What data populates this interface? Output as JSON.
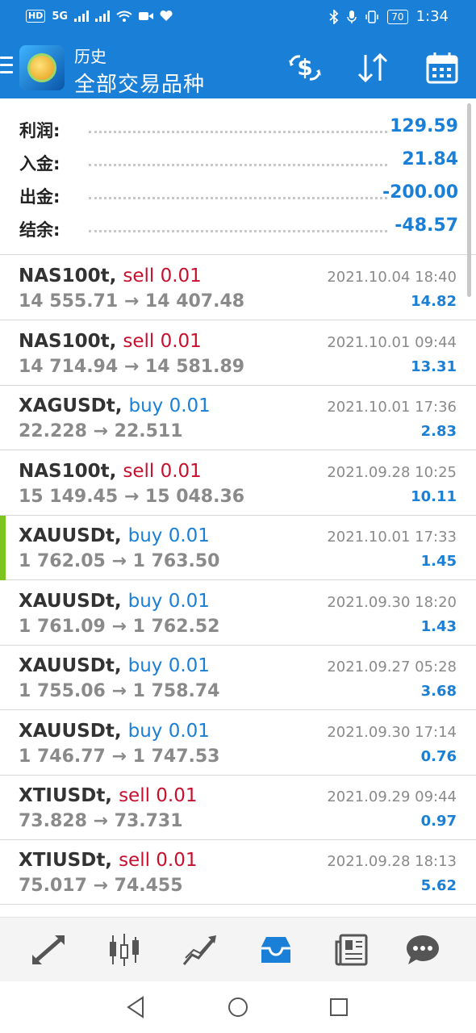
{
  "status_bar": {
    "badges": [
      "HD",
      "5G",
      "HD"
    ],
    "battery": "70",
    "time": "1:34",
    "icons": [
      "signal-icon",
      "wifi-icon",
      "video-icon",
      "heart-icon",
      "bluetooth-icon",
      "mic-icon",
      "vibrate-icon",
      "battery-icon"
    ]
  },
  "app_bar": {
    "subtitle": "历史",
    "title": "全部交易品种",
    "icons": [
      "currency-exchange-icon",
      "sort-icon",
      "calendar-icon"
    ]
  },
  "summary": [
    {
      "label": "利润:",
      "value": "129.59"
    },
    {
      "label": "入金:",
      "value": "21.84"
    },
    {
      "label": "出金:",
      "value": "-200.00"
    },
    {
      "label": "结余:",
      "value": "-48.57"
    }
  ],
  "trades": [
    {
      "symbol": "NAS100t,",
      "type": "sell 0.01",
      "side": "sell",
      "prices": "14 555.71 → 14 407.48",
      "time": "2021.10.04 18:40",
      "profit": "14.82"
    },
    {
      "symbol": "NAS100t,",
      "type": "sell 0.01",
      "side": "sell",
      "prices": "14 714.94 → 14 581.89",
      "time": "2021.10.01 09:44",
      "profit": "13.31"
    },
    {
      "symbol": "XAGUSDt,",
      "type": "buy 0.01",
      "side": "buy",
      "prices": "22.228 → 22.511",
      "time": "2021.10.01 17:36",
      "profit": "2.83"
    },
    {
      "symbol": "NAS100t,",
      "type": "sell 0.01",
      "side": "sell",
      "prices": "15 149.45 → 15 048.36",
      "time": "2021.09.28 10:25",
      "profit": "10.11"
    },
    {
      "symbol": "XAUUSDt,",
      "type": "buy 0.01",
      "side": "buy",
      "prices": "1 762.05 → 1 763.50",
      "time": "2021.10.01 17:33",
      "profit": "1.45"
    },
    {
      "symbol": "XAUUSDt,",
      "type": "buy 0.01",
      "side": "buy",
      "prices": "1 761.09 → 1 762.52",
      "time": "2021.09.30 18:20",
      "profit": "1.43"
    },
    {
      "symbol": "XAUUSDt,",
      "type": "buy 0.01",
      "side": "buy",
      "prices": "1 755.06 → 1 758.74",
      "time": "2021.09.27 05:28",
      "profit": "3.68"
    },
    {
      "symbol": "XAUUSDt,",
      "type": "buy 0.01",
      "side": "buy",
      "prices": "1 746.77 → 1 747.53",
      "time": "2021.09.30 17:14",
      "profit": "0.76"
    },
    {
      "symbol": "XTIUSDt,",
      "type": "sell 0.01",
      "side": "sell",
      "prices": "73.828 → 73.731",
      "time": "2021.09.29 09:44",
      "profit": "0.97"
    },
    {
      "symbol": "XTIUSDt,",
      "type": "sell 0.01",
      "side": "sell",
      "prices": "75.017 → 74.455",
      "time": "2021.09.28 18:13",
      "profit": "5.62"
    }
  ],
  "tabs": [
    "quotes-icon",
    "chart-icon",
    "trade-icon",
    "history-icon",
    "news-icon",
    "chat-icon"
  ],
  "colors": {
    "primary": "#1a7fd6",
    "sell": "#c8102e",
    "buy": "#1a7fd6",
    "selected": "#7cc51f"
  }
}
